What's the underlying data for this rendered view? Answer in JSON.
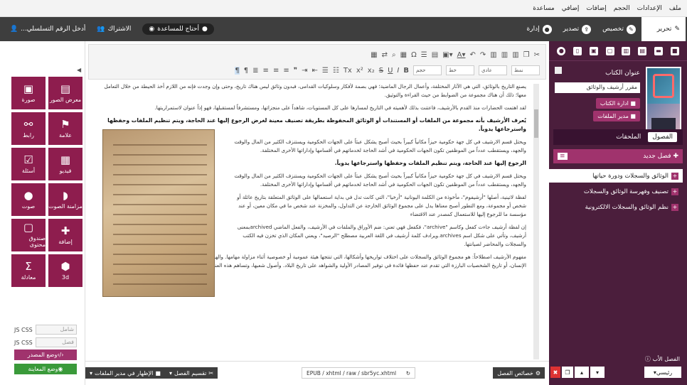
{
  "menu": [
    "ملف",
    "الإعدادات",
    "الحجم",
    "إضافات",
    "إضافي",
    "مساعدة"
  ],
  "toolbar": {
    "edit": "تحرير",
    "customize": "تخصيص",
    "design": "تصدير",
    "manage": "إدارة",
    "help": "أحتاج للمساعدة",
    "subscription": "الاشتراك",
    "serial": "أدخل الرقم التسلسلي..."
  },
  "sidebar": {
    "cover_label": "عنوان الكتاب",
    "title_value": "مقرر أرشيف والوثائق",
    "manage_book": "ادارة الكتاب",
    "file_manager": "مدير الملفات",
    "tab_chapters": "الفصول",
    "tab_attachments": "الملحقات",
    "new_chapter": "فصل جديد",
    "chapters": [
      "الوثائق والسجلات ودورة حياتها",
      "تصنيف وفهرسة الوثائق والسجلات",
      "نظم الوثائق والسجلات الالكترونية"
    ],
    "first_chapter_label": "الفصل الأب",
    "main_select": "رئيسي",
    "colors": {
      "bg": "#4b1e3c",
      "accent": "#a0336d"
    }
  },
  "tools": [
    {
      "label": "صورة",
      "icon": "image-icon"
    },
    {
      "label": "معرض الصور",
      "icon": "gallery-icon"
    },
    {
      "label": "رابط",
      "icon": "link-icon"
    },
    {
      "label": "علامة",
      "icon": "flag-icon"
    },
    {
      "label": "أسئلة",
      "icon": "check-icon"
    },
    {
      "label": "فيديو",
      "icon": "film-icon"
    },
    {
      "label": "صوت",
      "icon": "mic-icon"
    },
    {
      "label": "مزامنة الصوت",
      "icon": "chat-icon"
    },
    {
      "label": "صندوق محتوى",
      "icon": "box-icon"
    },
    {
      "label": "إضافة",
      "icon": "puzzle-icon"
    },
    {
      "label": "معادلة",
      "icon": "sigma-icon"
    },
    {
      "label": "3d",
      "icon": "cube-icon"
    }
  ],
  "left_bottom": {
    "css_js": "JS  CSS",
    "field1": "شامل",
    "field2": "فصل",
    "source_mode": "وضع المصدر",
    "preview_mode": "وضع المعاينة"
  },
  "editor": {
    "format": "عادي",
    "style": "نمط",
    "size": "حجم",
    "font": "خط",
    "p1": "يصنع التاريخ بالوثائق، التي هي الآثار المختلفة، وأعمال الرجال الماضية؛ فهي بصمة لأفكار وسلوكيات القدامى، فبدون وثائق ليس هناك تاريخ، وحتى وإن وجدت فإنه من اللازم أخذ الحيطة من خلال التعامل معها؛ ذلك أن هناك مجموعة من الضوابط من حيث القراءة والتوثيق.",
    "p2": "لقد اهتمت الحضارات منذ القدم بالأرشيف، فاعتنت بذلك لأهميته في التاريخ لمسارها على كل المستويات، شاهداً على منجزاتها، ومستشرفاً لمستقبلها، فهو إذاً عنوان لاستمراريتها.",
    "h1": "يُعرف الأرشيف بأنه مجموعة من الملفات أو المستندات أو الوثائق المحفوظة بطريقة تصنيف معينة لغرض الرجوع إليها عند الحاجة، ويتم تنظيم الملفات وحفظها واسترجاعها يدوياً.",
    "p3": "ويحتل قسم الارشيف في كل جهة حكومية حيزاً مكانياً كبيراً بحيث أصبح يشكل عبئاً على الجهات الحكومية ويستنزف الكثير من المال والوقت والجهد، ويستقطب عدداً من الموظفين تكون الجهات الحكومية في أشد الحاجة لخدماتهم في أقسامها وإداراتها الأخرى المختلفة.",
    "h2": "الرجوع إليها عند الحاجة، ويتم تنظيم الملفات وحفظها واسترجاعها يدوياً.",
    "p4": "ويحتل قسم الارشيف في كل جهة حكومية حيزاً مكانياً كبيراً بحيث أصبح يشكل عبئاً على الجهات الحكومية ويستنزف الكثير من المال والوقت والجهد، ويستقطب عدداً من الموظفين تكون الجهات الحكومية في أشد الحاجة لخدماتهم في أقسامها وإداراتها الأخرى المختلفة.",
    "p5": "لفظة لاتينية، أصلها \"أرشيفوم\"، مأخوذة من الكلمة اليونانية \"أرخيا\"، التي كانت تدل في بداية استعمالها على الوثائق المتعلقة بتاريخ عائلة أو شخص أو مجموعة، ومع التطور أصبح معناها يدل على مجموع الوثائق الخارجة عن التداول، والمخزنة عند شخص ما في مكان معين، أو عند مؤسسة ما للرجوع إليها للاستعمال كمصدر عند الاقتضاء",
    "p6": "إن لفظة أرشيف جاءت كفعل وكاسم \"archive\"، فكفعل فهي تعني: ضم الأوراق والملفات في الأرشيف، والفعل الماضي archivedبمعنى أرشيف، وتأتي على شكل اسم archives.ويرادف كلمة أرشيف في اللغة العربية مصطلح \"الرصيد\"، ويعني المكان الذي تخزن فيه الكتب والسجلات والمحاضر لصيانتها.",
    "p7": "مفهوم الأرشيف اصطلاحاً: هو مجموع الوثائق والسجلات على اختلاف تواريخها وأشكالها، التي تنتجها هيئة عمومية أو خصوصية أثناء مزاولة مهامها. والهدف منه هو حفظ هذه المواد، وحفظ ما يخص تاريخ الإنسان، أو تاريخ الشخصيات البارزة التي تقدم عند حفظها فائدة في توفير المصادر الأولية والشواهد على تاريخ البلاد. وأصول شعبها، وتساهم هذه العناصر في التوثيق التاريخي والبحث العلمي."
  },
  "bottom": {
    "chapter_props": "خصائص الفصل",
    "path": "EPUB / xhtml / raw / sbr5yc.xhtml",
    "split": "تقسيم الفصل",
    "show_in_manager": "الإظهار في مدير الملفات"
  }
}
